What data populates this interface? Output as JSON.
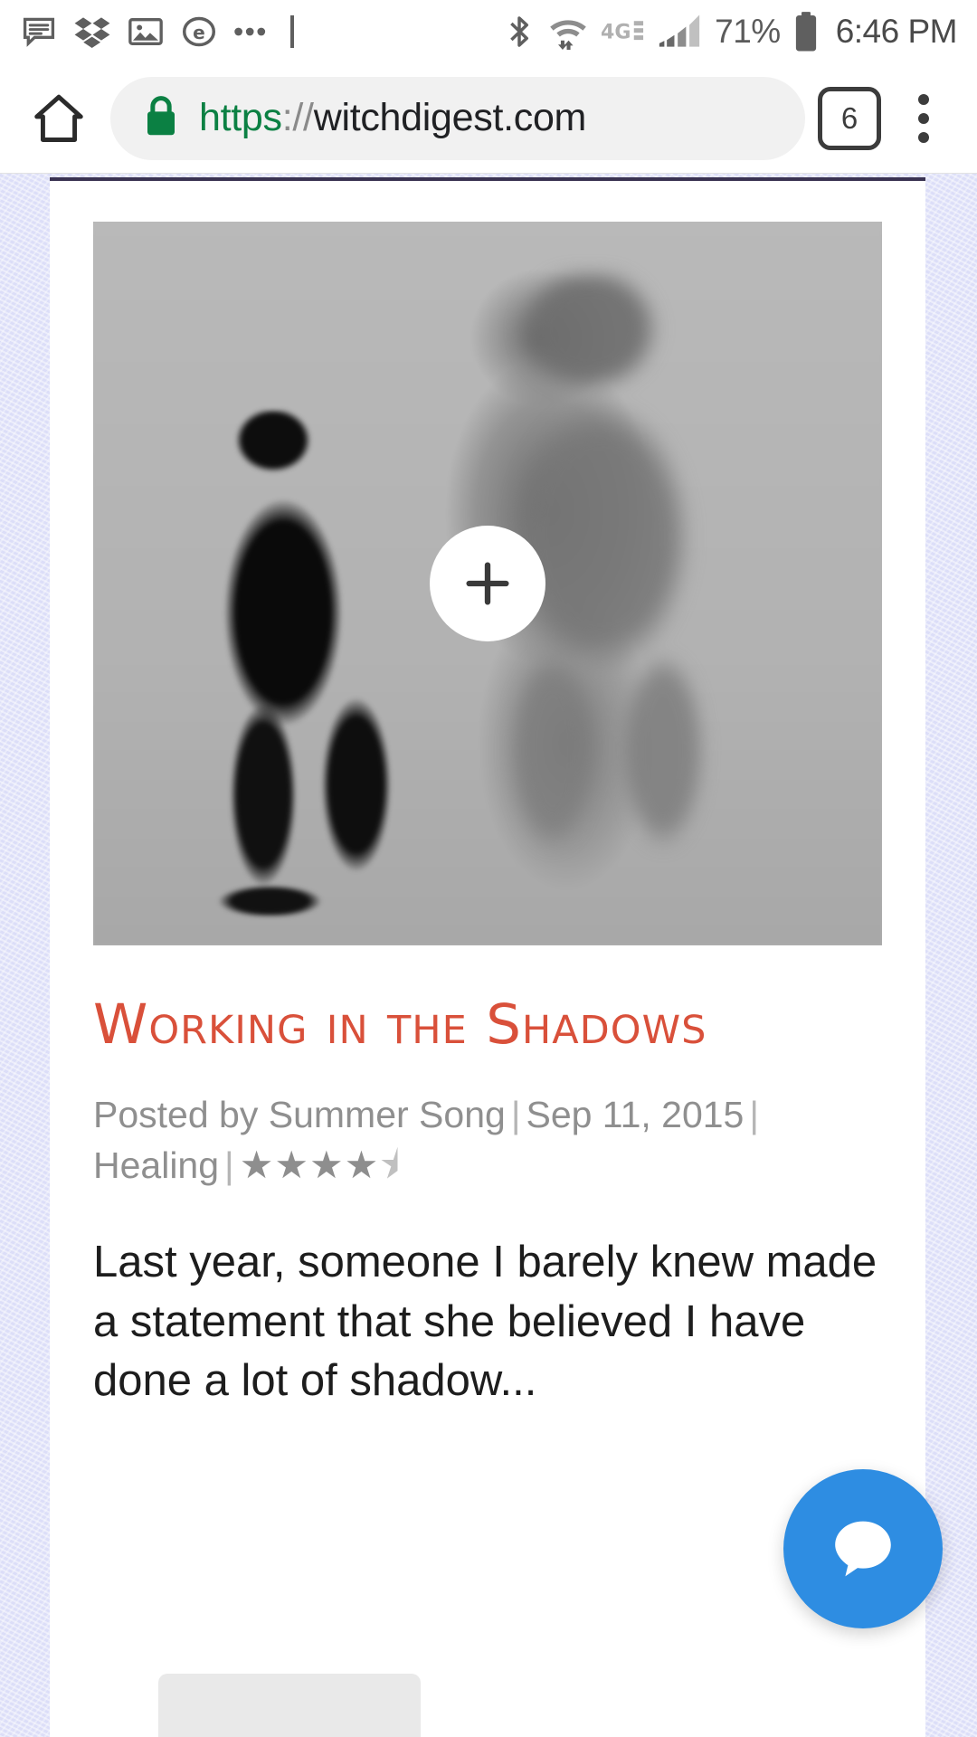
{
  "status_bar": {
    "left_icons": [
      {
        "name": "message-icon",
        "label": "Messages"
      },
      {
        "name": "dropbox-icon",
        "label": "Dropbox"
      },
      {
        "name": "gallery-icon",
        "label": "Gallery"
      },
      {
        "name": "edge-icon",
        "label": "Edge"
      },
      {
        "name": "more-notifications-icon",
        "label": "More"
      }
    ],
    "right_icons": [
      {
        "name": "bluetooth-icon",
        "label": "Bluetooth"
      },
      {
        "name": "wifi-icon",
        "label": "Wi-Fi"
      },
      {
        "name": "network-type-icon",
        "label": "4G"
      },
      {
        "name": "cellular-signal-icon",
        "label": "Signal"
      }
    ],
    "network_type": "4G",
    "battery_percent": "71%",
    "clock": "6:46 PM"
  },
  "browser": {
    "home_label": "Home",
    "url_scheme": "https",
    "url_separator": "://",
    "url_host": "witchdigest.com",
    "url_full": "https://witchdigest.com",
    "tab_count": "6",
    "menu_label": "More options",
    "secure_label": "Secure"
  },
  "post": {
    "image_alt": "Silhouette of a person casting a large blurred shadow",
    "expand_label": "+",
    "title": "Working in the Shadows",
    "posted_by_prefix": "Posted by",
    "author": "Summer Song",
    "date": "Sep 11, 2015",
    "category": "Healing",
    "separator": "|",
    "rating_stars": "★★★★",
    "rating_half_star": "⯨",
    "rating_value": "4.5",
    "excerpt": "Last year, someone I barely knew made a statement that she believed I have done a lot of shadow..."
  },
  "chat_widget": {
    "label": "Chat",
    "icon": "chat-bubble-icon",
    "color": "#2e8de2"
  },
  "colors": {
    "page_background": "#dcdef8",
    "card_background": "#ffffff",
    "title_accent": "#d9503a",
    "meta_text": "#8f8f8f",
    "body_text": "#1d1d1d",
    "omnibox_background": "#f1f1f1",
    "lock_green": "#0b8043",
    "chat_blue": "#2e8de2"
  }
}
